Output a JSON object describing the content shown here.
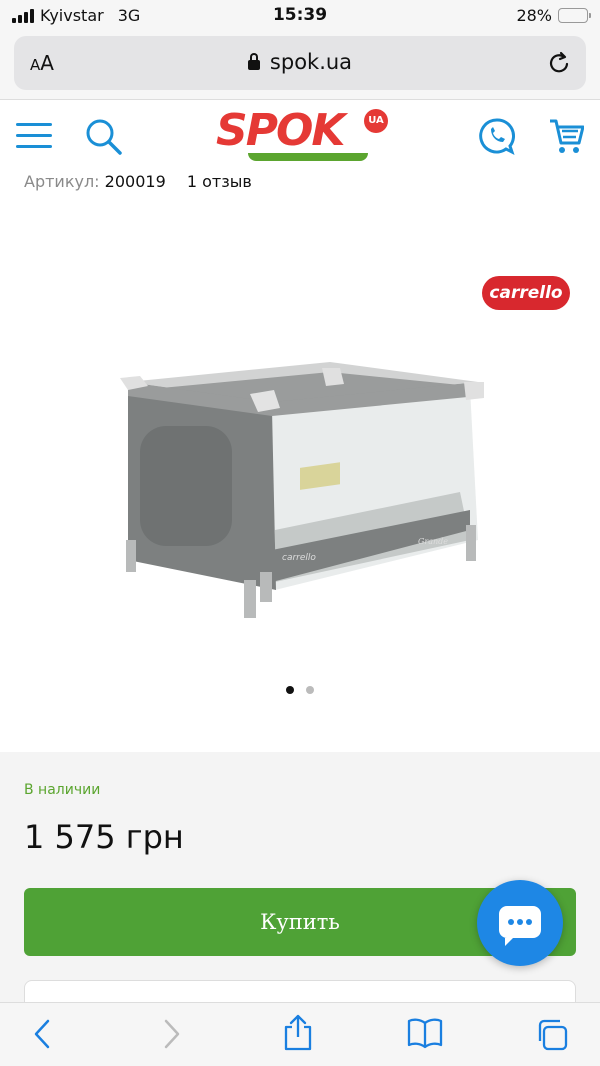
{
  "status_bar": {
    "carrier": "Kyivstar",
    "network": "3G",
    "time": "15:39",
    "battery": "28%",
    "battery_level": 0.28
  },
  "browser": {
    "text_size_button": "AA",
    "url": "spok.ua",
    "reload_icon": "reload-icon",
    "lock_icon": "lock-icon"
  },
  "header": {
    "logo_text": "SPOK",
    "logo_badge": "UA",
    "menu_icon": "hamburger-menu-icon",
    "search_icon": "search-icon",
    "phone_icon": "phone-chat-icon",
    "cart_icon": "cart-icon"
  },
  "product": {
    "article_label": "Артикул:",
    "article_number": "200019",
    "reviews": "1 отзыв",
    "brand_badge": "carrello",
    "image_brand": "carrello",
    "image_model": "Grande",
    "gallery_dots": 2,
    "gallery_active": 0,
    "stock_status": "В наличии",
    "price": "1 575 грн",
    "buy_button": "Купить"
  },
  "colors": {
    "brand_red": "#e53935",
    "brand_green": "#5ba52f",
    "buy_green": "#4fa236",
    "icon_blue": "#1a8fd6",
    "chat_blue": "#1e87e5"
  },
  "toolbar": {
    "back_icon": "chevron-left-icon",
    "forward_icon": "chevron-right-icon",
    "share_icon": "share-icon",
    "bookmarks_icon": "book-icon",
    "tabs_icon": "tabs-icon"
  }
}
